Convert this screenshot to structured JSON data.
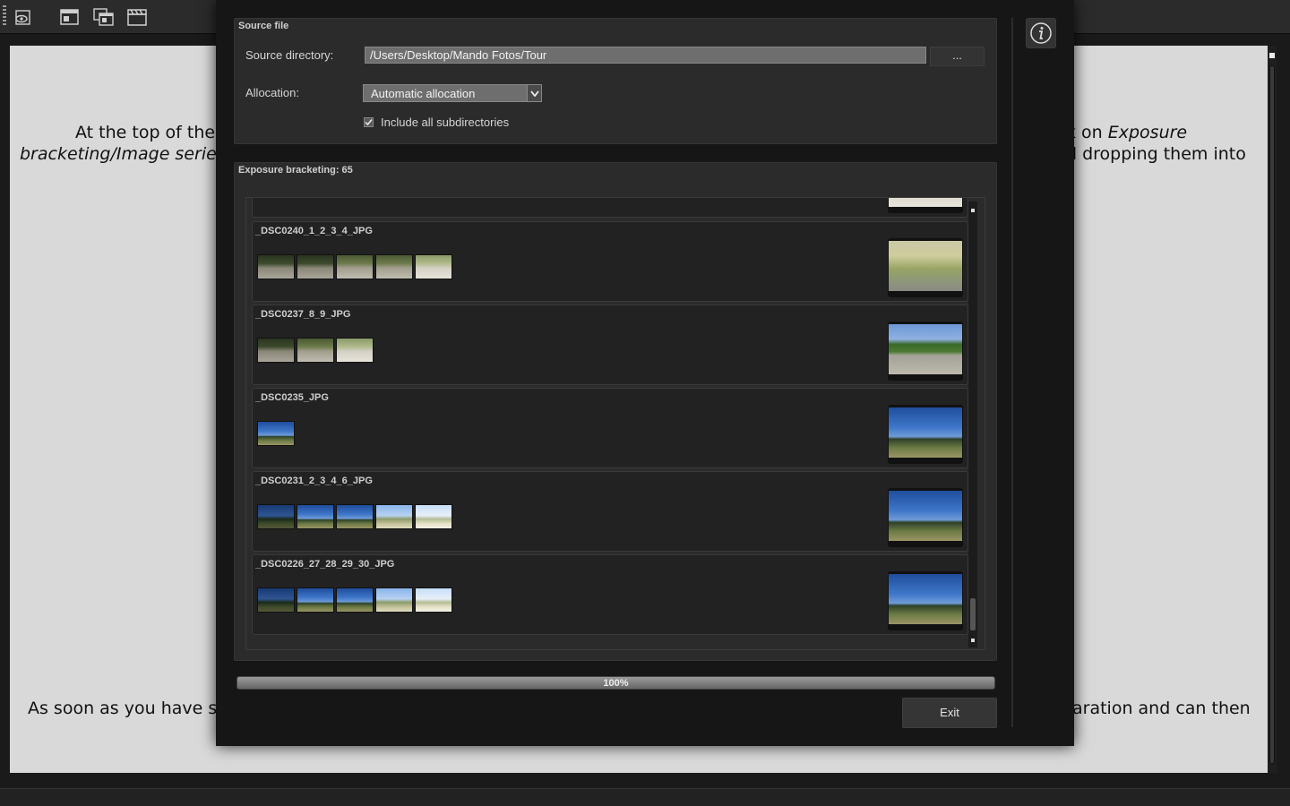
{
  "toolbar": {
    "buttons": [
      {
        "name": "eye-document-icon"
      },
      {
        "name": "window-icon"
      },
      {
        "name": "windows-stack-icon"
      },
      {
        "name": "clapperboard-icon"
      }
    ]
  },
  "document": {
    "line1_left": "At the top of the",
    "line2_left_italic": "bracketing/Image serie",
    "line1_right_plain": "k on ",
    "line1_right_italic": "Exposure",
    "line2_right": "d dropping them into",
    "line3_left": "As soon as you have s",
    "line3_right": "aration and can then"
  },
  "dialog": {
    "source": {
      "title": "Source file",
      "directory_label": "Source directory:",
      "directory_value": "/Users/Desktop/Mando Fotos/Tour",
      "browse_label": "...",
      "allocation_label": "Allocation:",
      "allocation_value": "Automatic allocation",
      "include_label": "Include all subdirectories",
      "include_checked": true
    },
    "bracketing": {
      "title": "Exposure bracketing: 65",
      "rows": [
        {
          "name": "_DSC0240_1_2_3_4_JPG",
          "thumbs": [
            "ph-gravel",
            "ph-gravel",
            "ph-gravel-mid",
            "ph-gravel-mid",
            "ph-gravel-bright"
          ],
          "result": "ph-field"
        },
        {
          "name": "_DSC0237_8_9_JPG",
          "thumbs": [
            "ph-gravel",
            "ph-gravel-mid",
            "ph-gravel-bright"
          ],
          "result": "ph-trees"
        },
        {
          "name": "_DSC0235_JPG",
          "thumbs": [
            "ph-sky"
          ],
          "result": "ph-sky"
        },
        {
          "name": "_DSC0231_2_3_4_6_JPG",
          "thumbs": [
            "ph-sky-dark",
            "ph-sky",
            "ph-sky",
            "ph-sky-bright",
            "ph-sky-white"
          ],
          "result": "ph-sky"
        },
        {
          "name": "_DSC0226_27_28_29_30_JPG",
          "thumbs": [
            "ph-sky-dark",
            "ph-sky",
            "ph-sky",
            "ph-sky-bright",
            "ph-sky-white"
          ],
          "result": "ph-sky"
        }
      ]
    },
    "progress": {
      "value": 1.0,
      "label": "100%"
    },
    "exit_label": "Exit",
    "info_icon": "info-icon"
  }
}
